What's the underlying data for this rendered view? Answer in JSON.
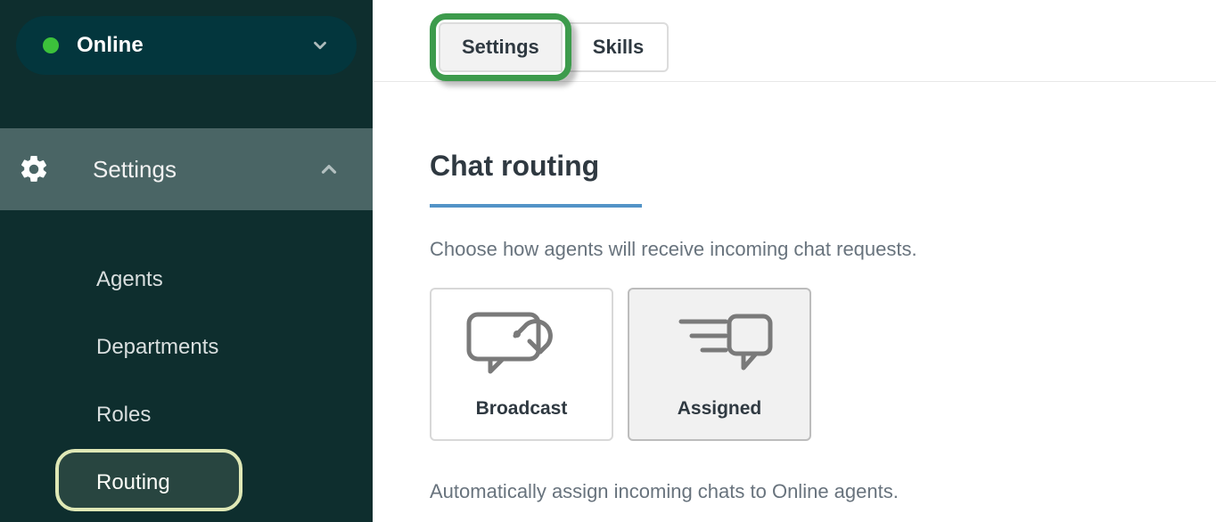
{
  "sidebar": {
    "status": {
      "label": "Online",
      "color": "#3cc13b"
    },
    "section_label": "Settings",
    "items": [
      {
        "label": "Agents"
      },
      {
        "label": "Departments"
      },
      {
        "label": "Roles"
      },
      {
        "label": "Routing",
        "active": true
      }
    ]
  },
  "tabs": {
    "settings": {
      "label": "Settings",
      "active": true,
      "highlighted": true
    },
    "skills": {
      "label": "Skills"
    }
  },
  "main": {
    "section_title": "Chat routing",
    "description": "Choose how agents will receive incoming chat requests.",
    "routing_options": {
      "broadcast": {
        "label": "Broadcast",
        "selected": false
      },
      "assigned": {
        "label": "Assigned",
        "selected": true
      }
    },
    "assigned_note": "Automatically assign incoming chats to Online agents."
  }
}
